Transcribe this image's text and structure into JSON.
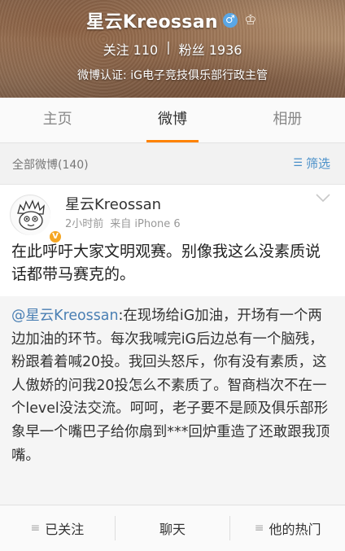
{
  "profile": {
    "name": "星云Kreossan",
    "gender_icon": "♂",
    "crown_icon": "♔",
    "follow_label": "关注",
    "follow_count": "110",
    "separator": "|",
    "fans_label": "粉丝",
    "fans_count": "1936",
    "verification": "微博认证: iG电子竞技俱乐部行政主管"
  },
  "tabs": [
    {
      "label": "主页"
    },
    {
      "label": "微博"
    },
    {
      "label": "相册"
    }
  ],
  "filter": {
    "count_label": "全部微博(140)",
    "filter_icon": "☰",
    "filter_label": "筛选"
  },
  "post": {
    "author": "星云Kreossan",
    "time": "2小时前",
    "source": "来自 iPhone 6",
    "text": "在此呼吁大家文明观赛。别像我这么没素质说话都带马赛克的。",
    "repost_mention": "@星云Kreossan",
    "repost_text": ":在现场给iG加油，开场有一个两边加油的环节。每次我喊完iG后边总有一个脑残，粉跟着着喊20投。我回头怒斥，你有没有素质，这人傲娇的问我20投怎么不素质了。智商档次不在一个level没法交流。呵呵，老子要不是顾及俱乐部形象早一个嘴巴子给你扇到***回炉重造了还敢跟我顶嘴。"
  },
  "bottom": {
    "followed_icon": "≡",
    "followed_label": "已关注",
    "chat_label": "聊天",
    "hot_icon": "≡",
    "hot_label": "他的热门"
  },
  "colors": {
    "accent": "#ff8200",
    "link": "#4a90c9",
    "badge": "#f5a623"
  }
}
